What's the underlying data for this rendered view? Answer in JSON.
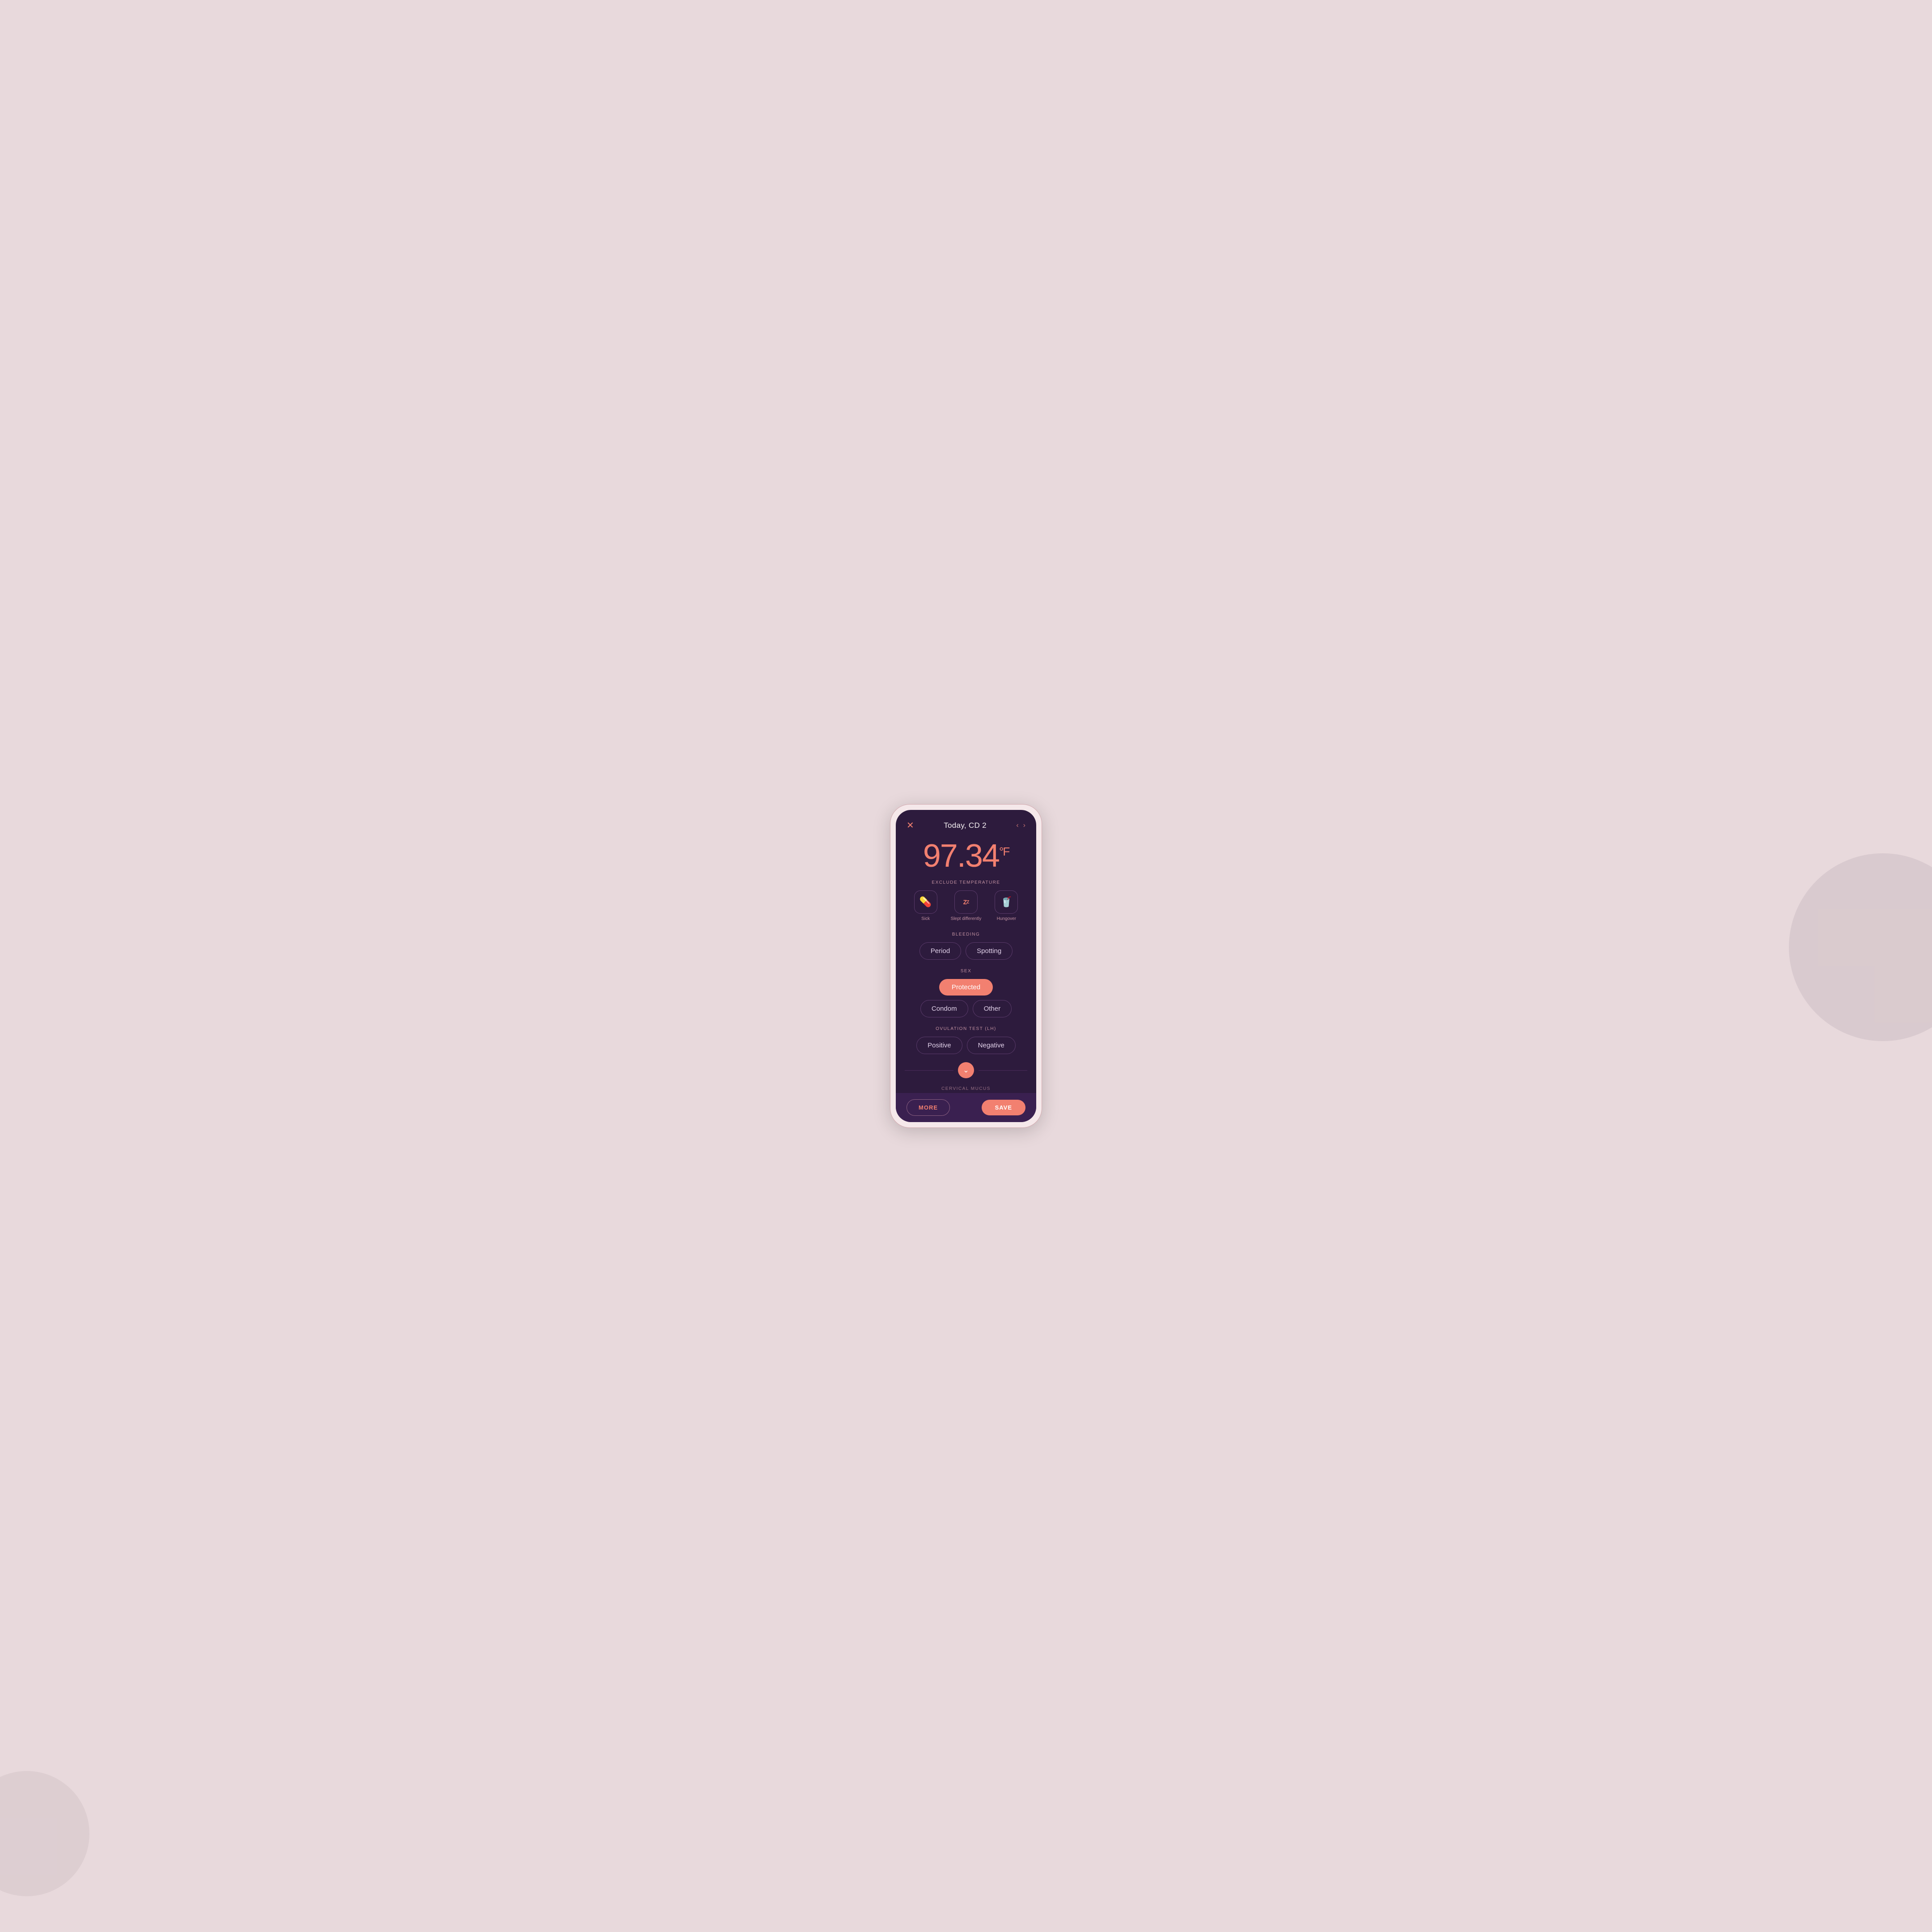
{
  "background": {
    "color": "#e8d9dc"
  },
  "header": {
    "close_label": "✕",
    "title": "Today, CD 2",
    "nav_left": "‹",
    "nav_right": "›"
  },
  "temperature": {
    "value": "97.34",
    "unit": "°F"
  },
  "exclude_temperature": {
    "label": "EXCLUDE TEMPERATURE",
    "items": [
      {
        "id": "sick",
        "icon": "💊",
        "label": "Sick"
      },
      {
        "id": "slept-differently",
        "icon": "ZZ",
        "label": "Slept differently"
      },
      {
        "id": "hungover",
        "icon": "🥤",
        "label": "Hungover"
      }
    ]
  },
  "bleeding": {
    "label": "BLEEDING",
    "buttons": [
      {
        "id": "period",
        "label": "Period",
        "active": false
      },
      {
        "id": "spotting",
        "label": "Spotting",
        "active": false
      }
    ]
  },
  "sex": {
    "label": "SEX",
    "buttons": [
      {
        "id": "protected",
        "label": "Protected",
        "active": true
      },
      {
        "id": "condom",
        "label": "Condom",
        "active": false
      },
      {
        "id": "other",
        "label": "Other",
        "active": false
      }
    ]
  },
  "ovulation_test": {
    "label": "OVULATION TEST (LH)",
    "buttons": [
      {
        "id": "positive",
        "label": "Positive",
        "active": false
      },
      {
        "id": "negative",
        "label": "Negative",
        "active": false
      }
    ]
  },
  "partial": {
    "label": "CERVICAL MUCUS"
  },
  "footer": {
    "more_label": "MORE",
    "save_label": "SAVE"
  }
}
